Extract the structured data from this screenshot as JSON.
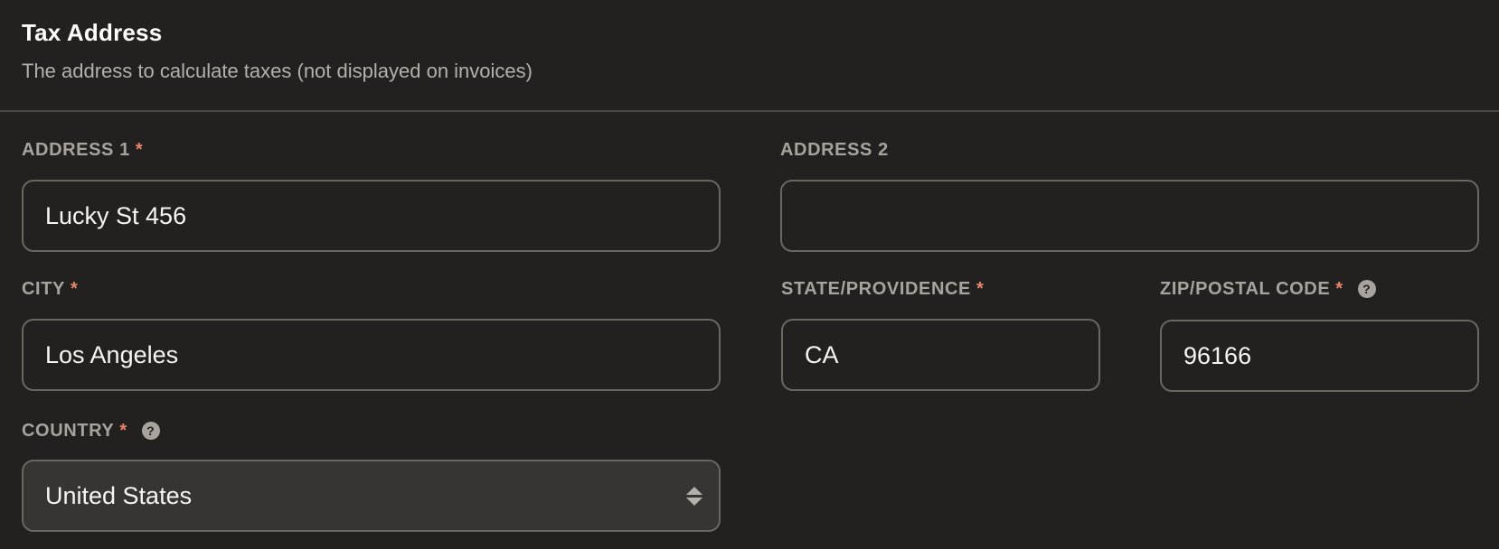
{
  "section": {
    "title": "Tax Address",
    "subtitle": "The address to calculate taxes (not displayed on invoices)"
  },
  "fields": {
    "address1": {
      "label": "ADDRESS 1",
      "required_mark": "*",
      "value": "Lucky St 456",
      "placeholder": ""
    },
    "address2": {
      "label": "ADDRESS 2",
      "value": "",
      "placeholder": ""
    },
    "city": {
      "label": "CITY",
      "required_mark": "*",
      "value": "Los Angeles",
      "placeholder": ""
    },
    "state": {
      "label": "STATE/PROVIDENCE",
      "required_mark": "*",
      "value": "CA",
      "placeholder": ""
    },
    "zip": {
      "label": "ZIP/POSTAL CODE",
      "required_mark": "*",
      "help_icon": "?",
      "value": "96166",
      "placeholder": ""
    },
    "country": {
      "label": "COUNTRY",
      "required_mark": "*",
      "help_icon": "?",
      "selected": "United States"
    }
  },
  "colors": {
    "background": "#222120",
    "required": "#e8866a",
    "label": "#a8a39c",
    "input_border": "#6a6761",
    "select_background": "#363532"
  },
  "icons": {
    "help": "question-circle-icon",
    "select": "up-down-arrows-icon"
  }
}
